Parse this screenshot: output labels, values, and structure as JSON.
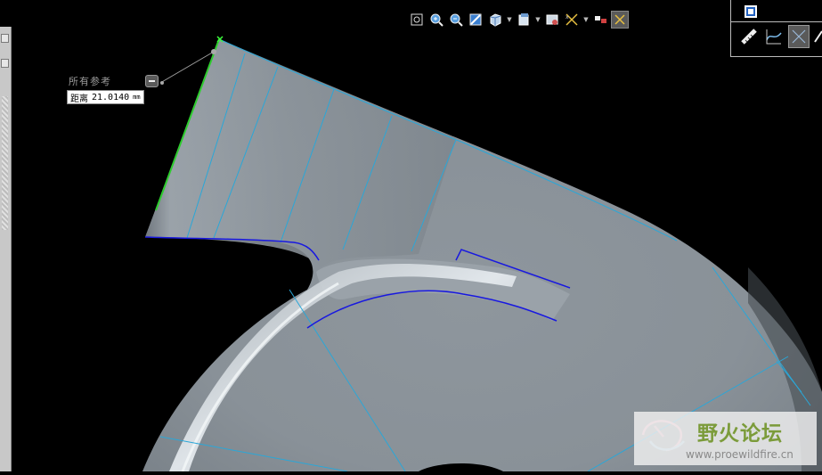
{
  "annotation": {
    "reference_label": "所有参考",
    "dimension_label": "距离",
    "dimension_value": "21.0140",
    "dimension_unit": "mm"
  },
  "toolbar": {
    "icons": [
      "refit-icon",
      "zoom-in-icon",
      "zoom-out-icon",
      "repaint-icon",
      "shading-icon",
      "views-icon",
      "view-manager-icon",
      "datum-display-icon",
      "spin-center-icon"
    ]
  },
  "watermark": {
    "title": "野火论坛",
    "url": "www.proewildfire.cn"
  },
  "colors": {
    "background": "#000000",
    "model_surface": "#8e969d",
    "edge_lines": "#2aa7d8",
    "selected_edge": "#1818e0",
    "measured_edge": "#2ecc2e",
    "watermark_green": "#7b9b3a"
  }
}
